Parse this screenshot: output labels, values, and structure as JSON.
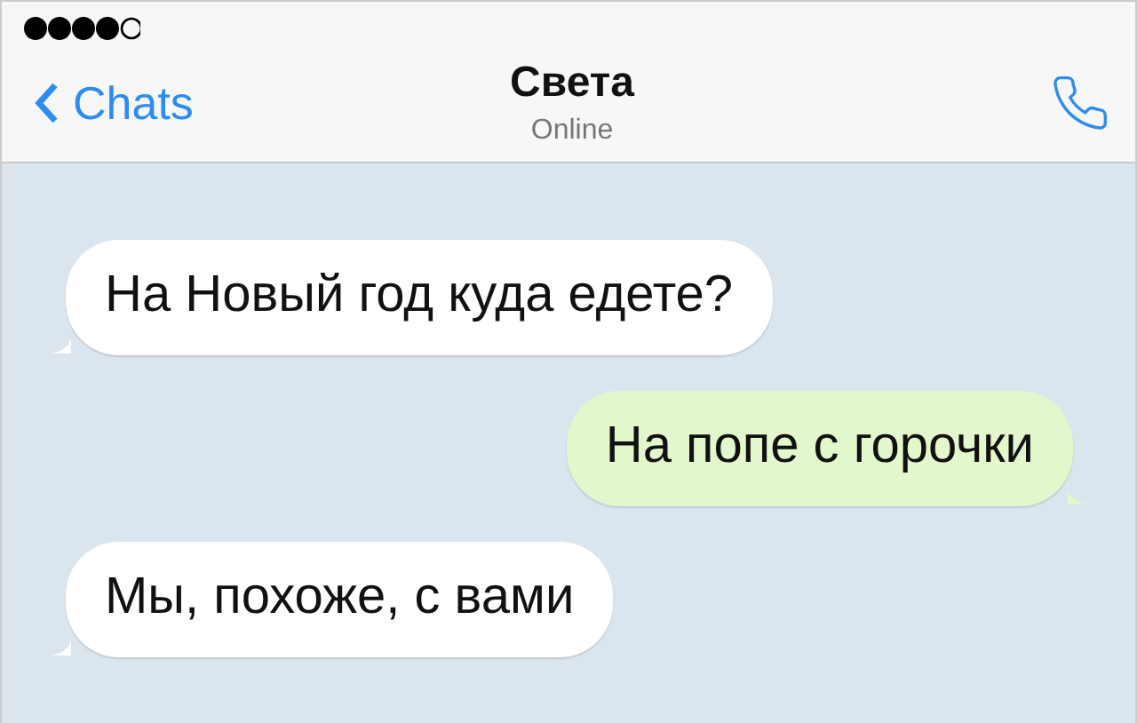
{
  "header": {
    "back_label": "Chats",
    "title": "Света",
    "subtitle": "Online"
  },
  "messages": [
    {
      "kind": "incoming",
      "text": "На Новый год куда едете?"
    },
    {
      "kind": "outgoing",
      "text": "На попе с горочки"
    },
    {
      "kind": "incoming",
      "text": "Мы, похоже, с вами"
    }
  ]
}
